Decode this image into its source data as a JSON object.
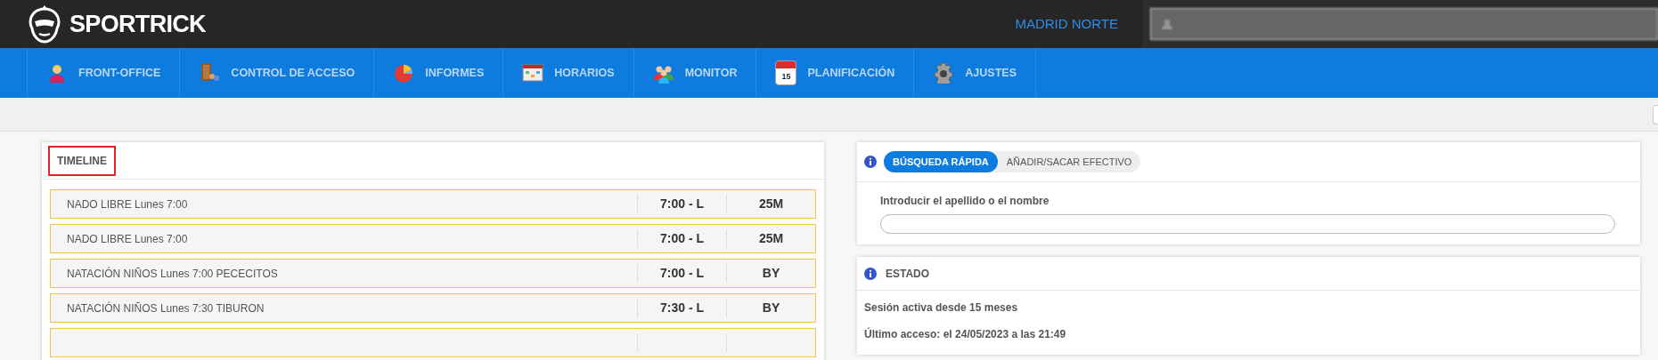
{
  "header": {
    "brand": "SPORTRICK",
    "location": "MADRID NORTE"
  },
  "nav": [
    {
      "label": "FRONT-OFFICE",
      "kind": "person"
    },
    {
      "label": "CONTROL DE ACCESO",
      "kind": "door"
    },
    {
      "label": "INFORMES",
      "kind": "pie"
    },
    {
      "label": "HORARIOS",
      "kind": "schedule"
    },
    {
      "label": "MONITOR",
      "kind": "group"
    },
    {
      "label": "PLANIFICACIÓN",
      "kind": "calendar",
      "icon_text": "15"
    },
    {
      "label": "AJUSTES",
      "kind": "gear"
    }
  ],
  "timeline": {
    "title": "TIMELINE",
    "outlined": true,
    "rows": [
      {
        "activity": "NADO LIBRE Lunes 7:00",
        "time": "7:00 - L",
        "code": "25M"
      },
      {
        "activity": "NADO LIBRE Lunes 7:00",
        "time": "7:00 - L",
        "code": "25M"
      },
      {
        "activity": "NATACIÓN NIÑOS Lunes 7:00 PECECITOS",
        "time": "7:00 - L",
        "code": "BY"
      },
      {
        "activity": "NATACIÓN NIÑOS Lunes 7:30 TIBURON",
        "time": "7:30 - L",
        "code": "BY"
      },
      {}
    ]
  },
  "search_card": {
    "tabs": [
      {
        "label": "BÚSQUEDA RÁPIDA",
        "selected": true
      },
      {
        "label": "AÑADIR/SACAR EFECTIVO",
        "selected": false
      }
    ],
    "field_label": "Introducir el apellido o el nombre"
  },
  "status_card": {
    "title": "ESTADO",
    "lines": [
      "Sesión activa desde 15 meses",
      "Último acceso: el 24/05/2023 a las 21:49"
    ]
  }
}
